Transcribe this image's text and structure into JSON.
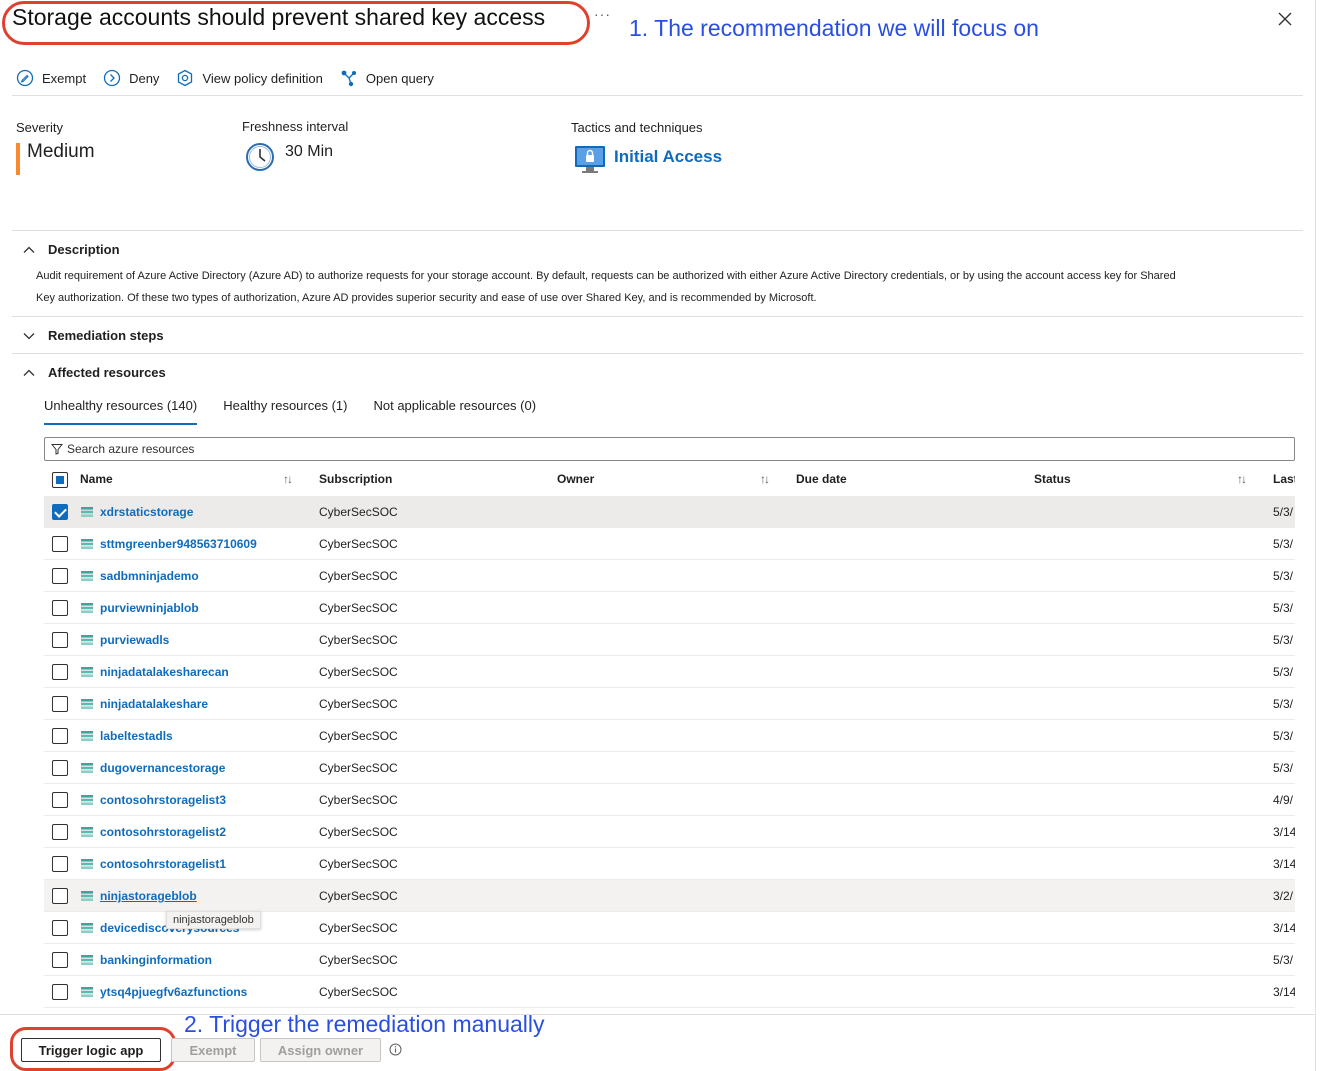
{
  "header": {
    "title": "Storage accounts should prevent shared key access",
    "more": "···",
    "annotation_1": "1. The recommendation we will focus on"
  },
  "toolbar": {
    "exempt": "Exempt",
    "deny": "Deny",
    "view_policy": "View policy definition",
    "open_query": "Open query"
  },
  "summary": {
    "severity_label": "Severity",
    "severity_value": "Medium",
    "severity_color": "#f7892f",
    "freshness_label": "Freshness interval",
    "freshness_value": "30 Min",
    "tactics_label": "Tactics and techniques",
    "tactics_value": "Initial Access"
  },
  "description": {
    "heading": "Description",
    "line1": "Audit requirement of Azure Active Directory (Azure AD) to authorize requests for your storage account. By default, requests can be authorized with either Azure Active Directory credentials, or by using the account access key for Shared",
    "line2": "Key authorization. Of these two types of authorization, Azure AD provides superior security and ease of use over Shared Key, and is recommended by Microsoft."
  },
  "remediation": {
    "heading": "Remediation steps"
  },
  "affected": {
    "heading": "Affected resources",
    "tabs": [
      "Unhealthy resources (140)",
      "Healthy resources (1)",
      "Not applicable resources (0)"
    ],
    "search_placeholder": "Search azure resources",
    "columns": [
      "Name",
      "Subscription",
      "Owner",
      "Due date",
      "Status",
      "Last"
    ],
    "rows": [
      {
        "name": "xdrstaticstorage",
        "subscription": "CyberSecSOC",
        "last": "5/3/"
      },
      {
        "name": "sttmgreenber948563710609",
        "subscription": "CyberSecSOC",
        "last": "5/3/"
      },
      {
        "name": "sadbmninjademo",
        "subscription": "CyberSecSOC",
        "last": "5/3/"
      },
      {
        "name": "purviewninjablob",
        "subscription": "CyberSecSOC",
        "last": "5/3/"
      },
      {
        "name": "purviewadls",
        "subscription": "CyberSecSOC",
        "last": "5/3/"
      },
      {
        "name": "ninjadatalakesharecan",
        "subscription": "CyberSecSOC",
        "last": "5/3/"
      },
      {
        "name": "ninjadatalakeshare",
        "subscription": "CyberSecSOC",
        "last": "5/3/"
      },
      {
        "name": "labeltestadls",
        "subscription": "CyberSecSOC",
        "last": "5/3/"
      },
      {
        "name": "dugovernancestorage",
        "subscription": "CyberSecSOC",
        "last": "5/3/"
      },
      {
        "name": "contosohrstoragelist3",
        "subscription": "CyberSecSOC",
        "last": "4/9/"
      },
      {
        "name": "contosohrstoragelist2",
        "subscription": "CyberSecSOC",
        "last": "3/14"
      },
      {
        "name": "contosohrstoragelist1",
        "subscription": "CyberSecSOC",
        "last": "3/14"
      },
      {
        "name": "ninjastorageblob",
        "subscription": "CyberSecSOC",
        "last": "3/2/"
      },
      {
        "name": "devicediscoverysources",
        "subscription": "CyberSecSOC",
        "last": "3/14"
      },
      {
        "name": "bankinginformation",
        "subscription": "CyberSecSOC",
        "last": "5/3/"
      },
      {
        "name": "ytsq4pjuegfv6azfunctions",
        "subscription": "CyberSecSOC",
        "last": "3/14"
      }
    ],
    "tooltip": "ninjastorageblob"
  },
  "footer": {
    "trigger": "Trigger logic app",
    "exempt": "Exempt",
    "assign_owner": "Assign owner",
    "annotation_2": "2. Trigger the remediation manually"
  }
}
